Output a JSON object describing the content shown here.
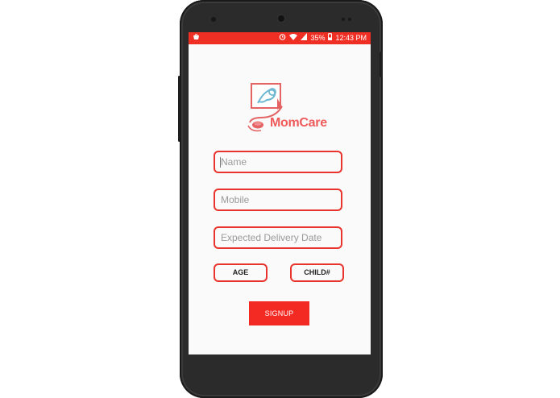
{
  "status_bar": {
    "notification_icon": "shop-bag-icon",
    "alarm_icon": "alarm-icon",
    "wifi_icon": "wifi-icon",
    "signal_icon": "signal-icon",
    "battery_percent": "35%",
    "battery_icon": "battery-icon",
    "time": "12:43 PM"
  },
  "app": {
    "name": "MomCare",
    "logo_icon": "baby-stethoscope-logo"
  },
  "form": {
    "name": {
      "placeholder": "Name",
      "value": ""
    },
    "mobile": {
      "placeholder": "Mobile",
      "value": ""
    },
    "expected_delivery_date": {
      "placeholder": "Expected Delivery Date",
      "value": ""
    },
    "age_label": "AGE",
    "child_label": "CHILD#",
    "signup_label": "SIGNUP"
  },
  "colors": {
    "accent": "#f02f24",
    "border": "#e9342d",
    "logo_text": "#ef5b5b",
    "background": "#fafafa"
  }
}
